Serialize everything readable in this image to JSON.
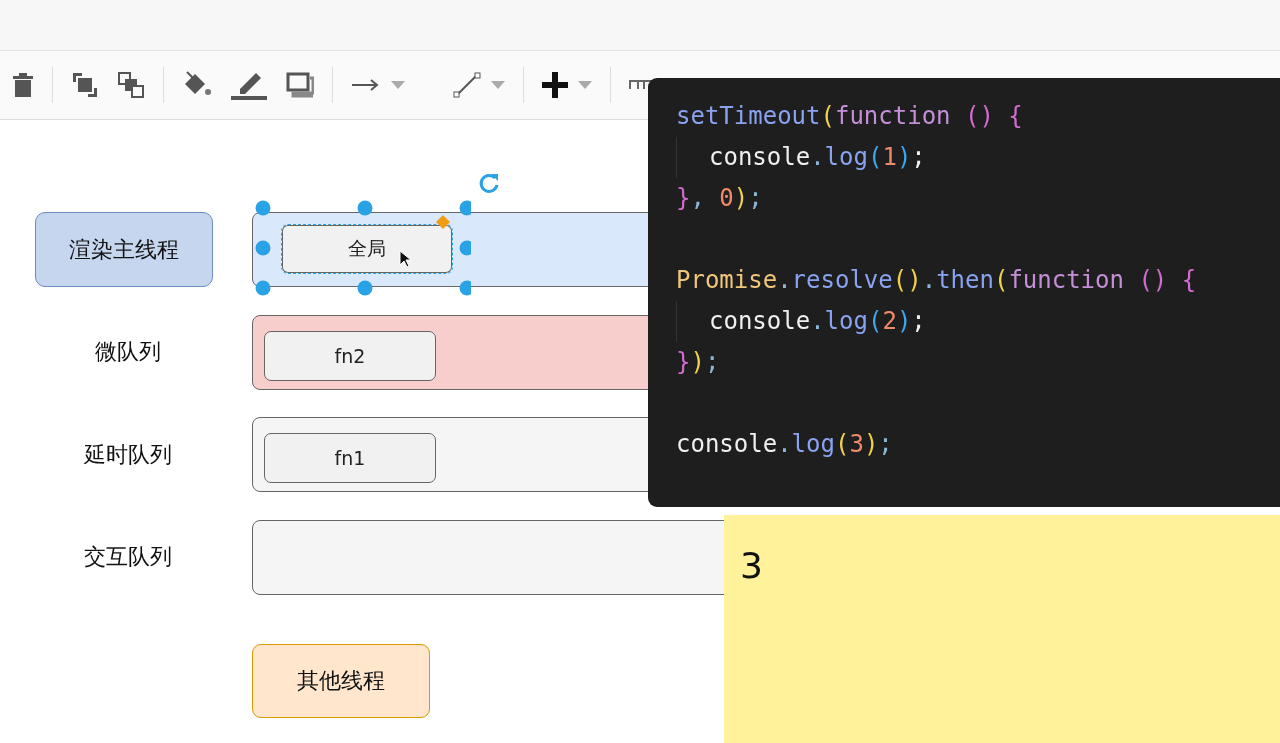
{
  "diagram": {
    "lanes": [
      {
        "label": "渲染主线程",
        "kind": "thread",
        "color": "#dae8fc",
        "tasks": [
          {
            "label": "全局",
            "selected": true
          }
        ]
      },
      {
        "label": "微队列",
        "kind": "queue",
        "color": "#f8cecc",
        "tasks": [
          {
            "label": "fn2",
            "selected": false
          }
        ]
      },
      {
        "label": "延时队列",
        "kind": "queue",
        "color": "#f5f5f5",
        "tasks": [
          {
            "label": "fn1",
            "selected": false
          }
        ]
      },
      {
        "label": "交互队列",
        "kind": "queue",
        "color": "#f5f5f5"
      }
    ],
    "other_thread": {
      "label": "其他线程"
    }
  },
  "code": {
    "blocks": [
      [
        {
          "indent": false,
          "tokens": [
            {
              "text": "setTimeout",
              "kind": "func"
            },
            {
              "text": "(",
              "kind": "paren1"
            },
            {
              "text": "function ",
              "kind": "keyword"
            },
            {
              "text": "() {",
              "kind": "paren2"
            }
          ]
        },
        {
          "indent": true,
          "tokens": [
            {
              "text": "console",
              "kind": "plain"
            },
            {
              "text": ".",
              "kind": "punct"
            },
            {
              "text": "log",
              "kind": "func"
            },
            {
              "text": "(",
              "kind": "paren3"
            },
            {
              "text": "1",
              "kind": "number"
            },
            {
              "text": ")",
              "kind": "paren3"
            },
            {
              "text": ";",
              "kind": "plain"
            }
          ]
        },
        {
          "indent": false,
          "tokens": [
            {
              "text": "}",
              "kind": "paren2"
            },
            {
              "text": ", ",
              "kind": "punct"
            },
            {
              "text": "0",
              "kind": "number"
            },
            {
              "text": ")",
              "kind": "paren1"
            },
            {
              "text": ";",
              "kind": "punct"
            }
          ]
        }
      ],
      [
        {
          "indent": false,
          "tokens": [
            {
              "text": "Promise",
              "kind": "class"
            },
            {
              "text": ".",
              "kind": "punct"
            },
            {
              "text": "resolve",
              "kind": "func"
            },
            {
              "text": "()",
              "kind": "paren1"
            },
            {
              "text": ".",
              "kind": "punct"
            },
            {
              "text": "then",
              "kind": "func"
            },
            {
              "text": "(",
              "kind": "paren1"
            },
            {
              "text": "function ",
              "kind": "keyword"
            },
            {
              "text": "() {",
              "kind": "paren2"
            }
          ]
        },
        {
          "indent": true,
          "tokens": [
            {
              "text": "console",
              "kind": "plain"
            },
            {
              "text": ".",
              "kind": "punct"
            },
            {
              "text": "log",
              "kind": "func"
            },
            {
              "text": "(",
              "kind": "paren3"
            },
            {
              "text": "2",
              "kind": "number"
            },
            {
              "text": ")",
              "kind": "paren3"
            },
            {
              "text": ";",
              "kind": "plain"
            }
          ]
        },
        {
          "indent": false,
          "tokens": [
            {
              "text": "}",
              "kind": "paren2"
            },
            {
              "text": ")",
              "kind": "paren1"
            },
            {
              "text": ";",
              "kind": "punct"
            }
          ]
        }
      ],
      [
        {
          "indent": false,
          "tokens": [
            {
              "text": "console",
              "kind": "plain"
            },
            {
              "text": ".",
              "kind": "punct"
            },
            {
              "text": "log",
              "kind": "func"
            },
            {
              "text": "(",
              "kind": "paren1"
            },
            {
              "text": "3",
              "kind": "number"
            },
            {
              "text": ")",
              "kind": "paren1"
            },
            {
              "text": ";",
              "kind": "punct"
            }
          ]
        }
      ]
    ]
  },
  "note": {
    "text": "3"
  }
}
